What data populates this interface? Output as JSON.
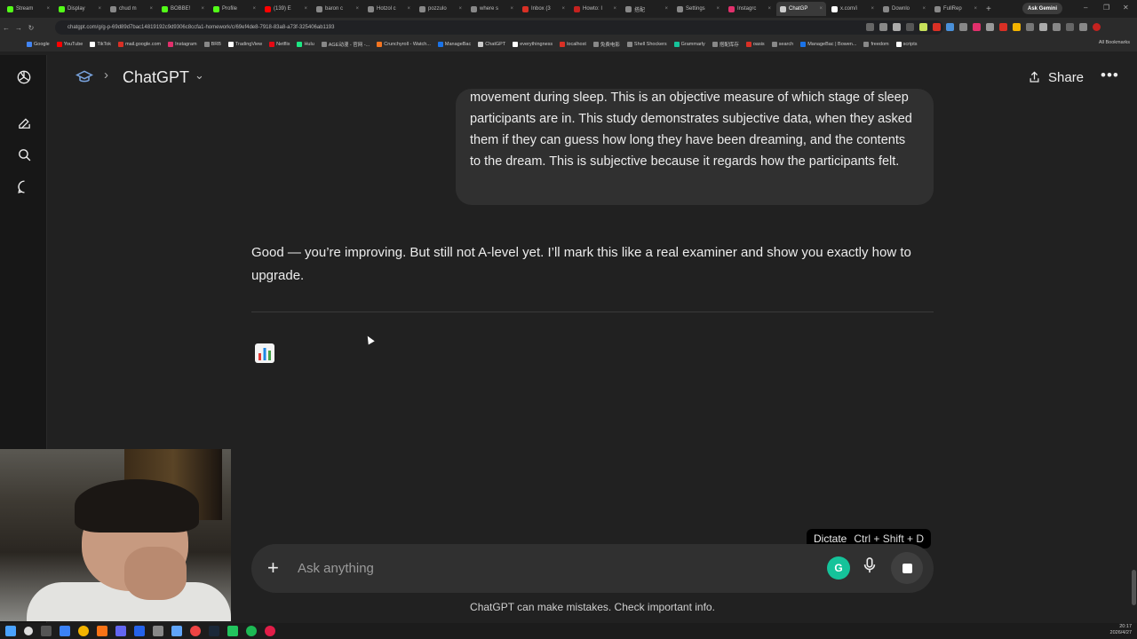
{
  "browser": {
    "tabs": [
      {
        "label": "Stream",
        "color": "#53fc18"
      },
      {
        "label": "Display",
        "color": "#53fc18"
      },
      {
        "label": "chud m",
        "color": "#888888"
      },
      {
        "label": "BOBBE!",
        "color": "#53fc18"
      },
      {
        "label": "Profile",
        "color": "#53fc18"
      },
      {
        "label": "(139) E",
        "color": "#ff0000"
      },
      {
        "label": "baron c",
        "color": "#888888"
      },
      {
        "label": "Hotzol c",
        "color": "#888888"
      },
      {
        "label": "pozzulo",
        "color": "#888888"
      },
      {
        "label": "where s",
        "color": "#888888"
      },
      {
        "label": "Inbox (3",
        "color": "#d93025"
      },
      {
        "label": "Howto: I",
        "color": "#c5221f"
      },
      {
        "label": "搭配",
        "color": "#888888"
      },
      {
        "label": "Settings",
        "color": "#888888"
      },
      {
        "label": "Instagrc",
        "color": "#e1306c"
      },
      {
        "label": "ChatGP",
        "color": "#cccccc",
        "active": true
      },
      {
        "label": "x.com/i",
        "color": "#ffffff"
      },
      {
        "label": "Downlo",
        "color": "#888888"
      },
      {
        "label": "FullRep",
        "color": "#888888"
      }
    ],
    "ask_gemini": "Ask Gemini",
    "url": "chatgpt.com/g/g-p-69d89d7bac14819192c9d9306c8ccfa1-homework/c/69ef4de8-7918-83a8-a73f-325406ab1193",
    "bookmarks": [
      {
        "label": "Google",
        "color": "#4285f4"
      },
      {
        "label": "YouTube",
        "color": "#ff0000"
      },
      {
        "label": "TikTok",
        "color": "#ffffff"
      },
      {
        "label": "mail.google.com",
        "color": "#d93025"
      },
      {
        "label": "Instagram",
        "color": "#e1306c"
      },
      {
        "label": "BRB",
        "color": "#888888"
      },
      {
        "label": "TradingView",
        "color": "#ffffff"
      },
      {
        "label": "Netflix",
        "color": "#e50914"
      },
      {
        "label": "Hulu",
        "color": "#1ce783"
      },
      {
        "label": "AGE动漫 - 官网 -...",
        "color": "#888888"
      },
      {
        "label": "Crunchyroll - Watch...",
        "color": "#f47521"
      },
      {
        "label": "ManageBac",
        "color": "#1a73e8"
      },
      {
        "label": "ChatGPT",
        "color": "#cccccc"
      },
      {
        "label": "everythingness",
        "color": "#ffffff"
      },
      {
        "label": "localhost",
        "color": "#d93025"
      },
      {
        "label": "免费电影",
        "color": "#888888"
      },
      {
        "label": "Shell Shockers",
        "color": "#888888"
      },
      {
        "label": "Grammarly",
        "color": "#15c39a"
      },
      {
        "label": "搭配库存",
        "color": "#888888"
      },
      {
        "label": "oasis",
        "color": "#d93025"
      },
      {
        "label": "search",
        "color": "#888888"
      },
      {
        "label": "ManageBac | Bowen...",
        "color": "#1a73e8"
      },
      {
        "label": "freedom",
        "color": "#888888"
      },
      {
        "label": "scripts",
        "color": "#ffffff"
      }
    ],
    "all_bookmarks": "All Bookmarks"
  },
  "header": {
    "title": "ChatGPT",
    "share_label": "Share"
  },
  "conversation": {
    "user_message": "movement during sleep. This is an objective measure of which stage of sleep participants are in. This study demonstrates subjective data, when they asked them if they can guess how long they have been dreaming, and the contents to the dream. This is subjective because it regards how the participants felt.",
    "assistant_reply": "Good — you’re improving. But still not A-level yet. I’ll mark this like a real examiner and show you exactly how to upgrade.",
    "assistant_emoji": "📊"
  },
  "tooltip": {
    "label": "Dictate",
    "shortcut": "Ctrl + Shift + D"
  },
  "composer": {
    "placeholder": "Ask anything",
    "grammarly_letter": "G"
  },
  "footer": {
    "disclaimer": "ChatGPT can make mistakes. Check important info."
  },
  "taskbar": {
    "time": "20:17",
    "date": "2026/4/27"
  }
}
